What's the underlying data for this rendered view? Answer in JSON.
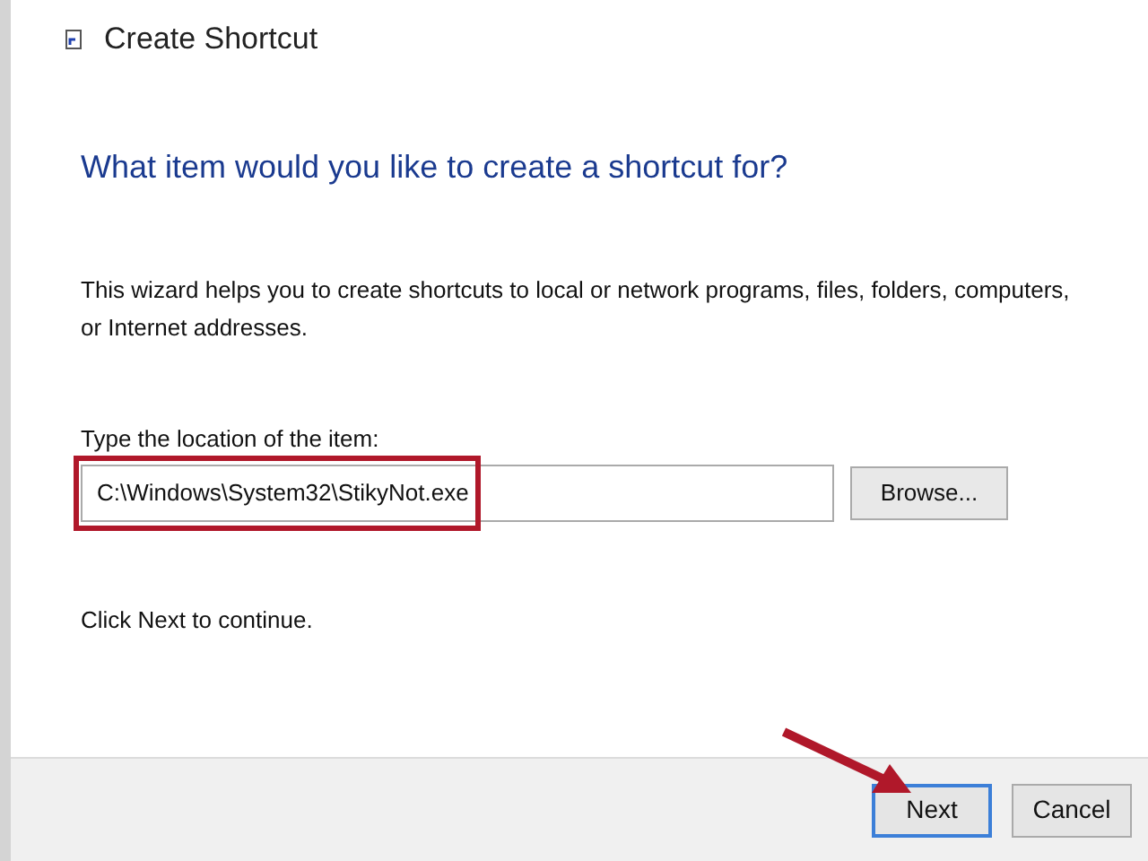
{
  "window": {
    "title": "Create Shortcut"
  },
  "heading": "What item would you like to create a shortcut for?",
  "description": "This wizard helps you to create shortcuts to local or network programs, files, folders, computers, or Internet addresses.",
  "location": {
    "label": "Type the location of the item:",
    "value": "C:\\Windows\\System32\\StikyNot.exe",
    "browse": "Browse..."
  },
  "hint": "Click Next to continue.",
  "buttons": [
    {
      "label": "Next",
      "default": true
    },
    {
      "label": "Cancel",
      "default": false
    }
  ]
}
